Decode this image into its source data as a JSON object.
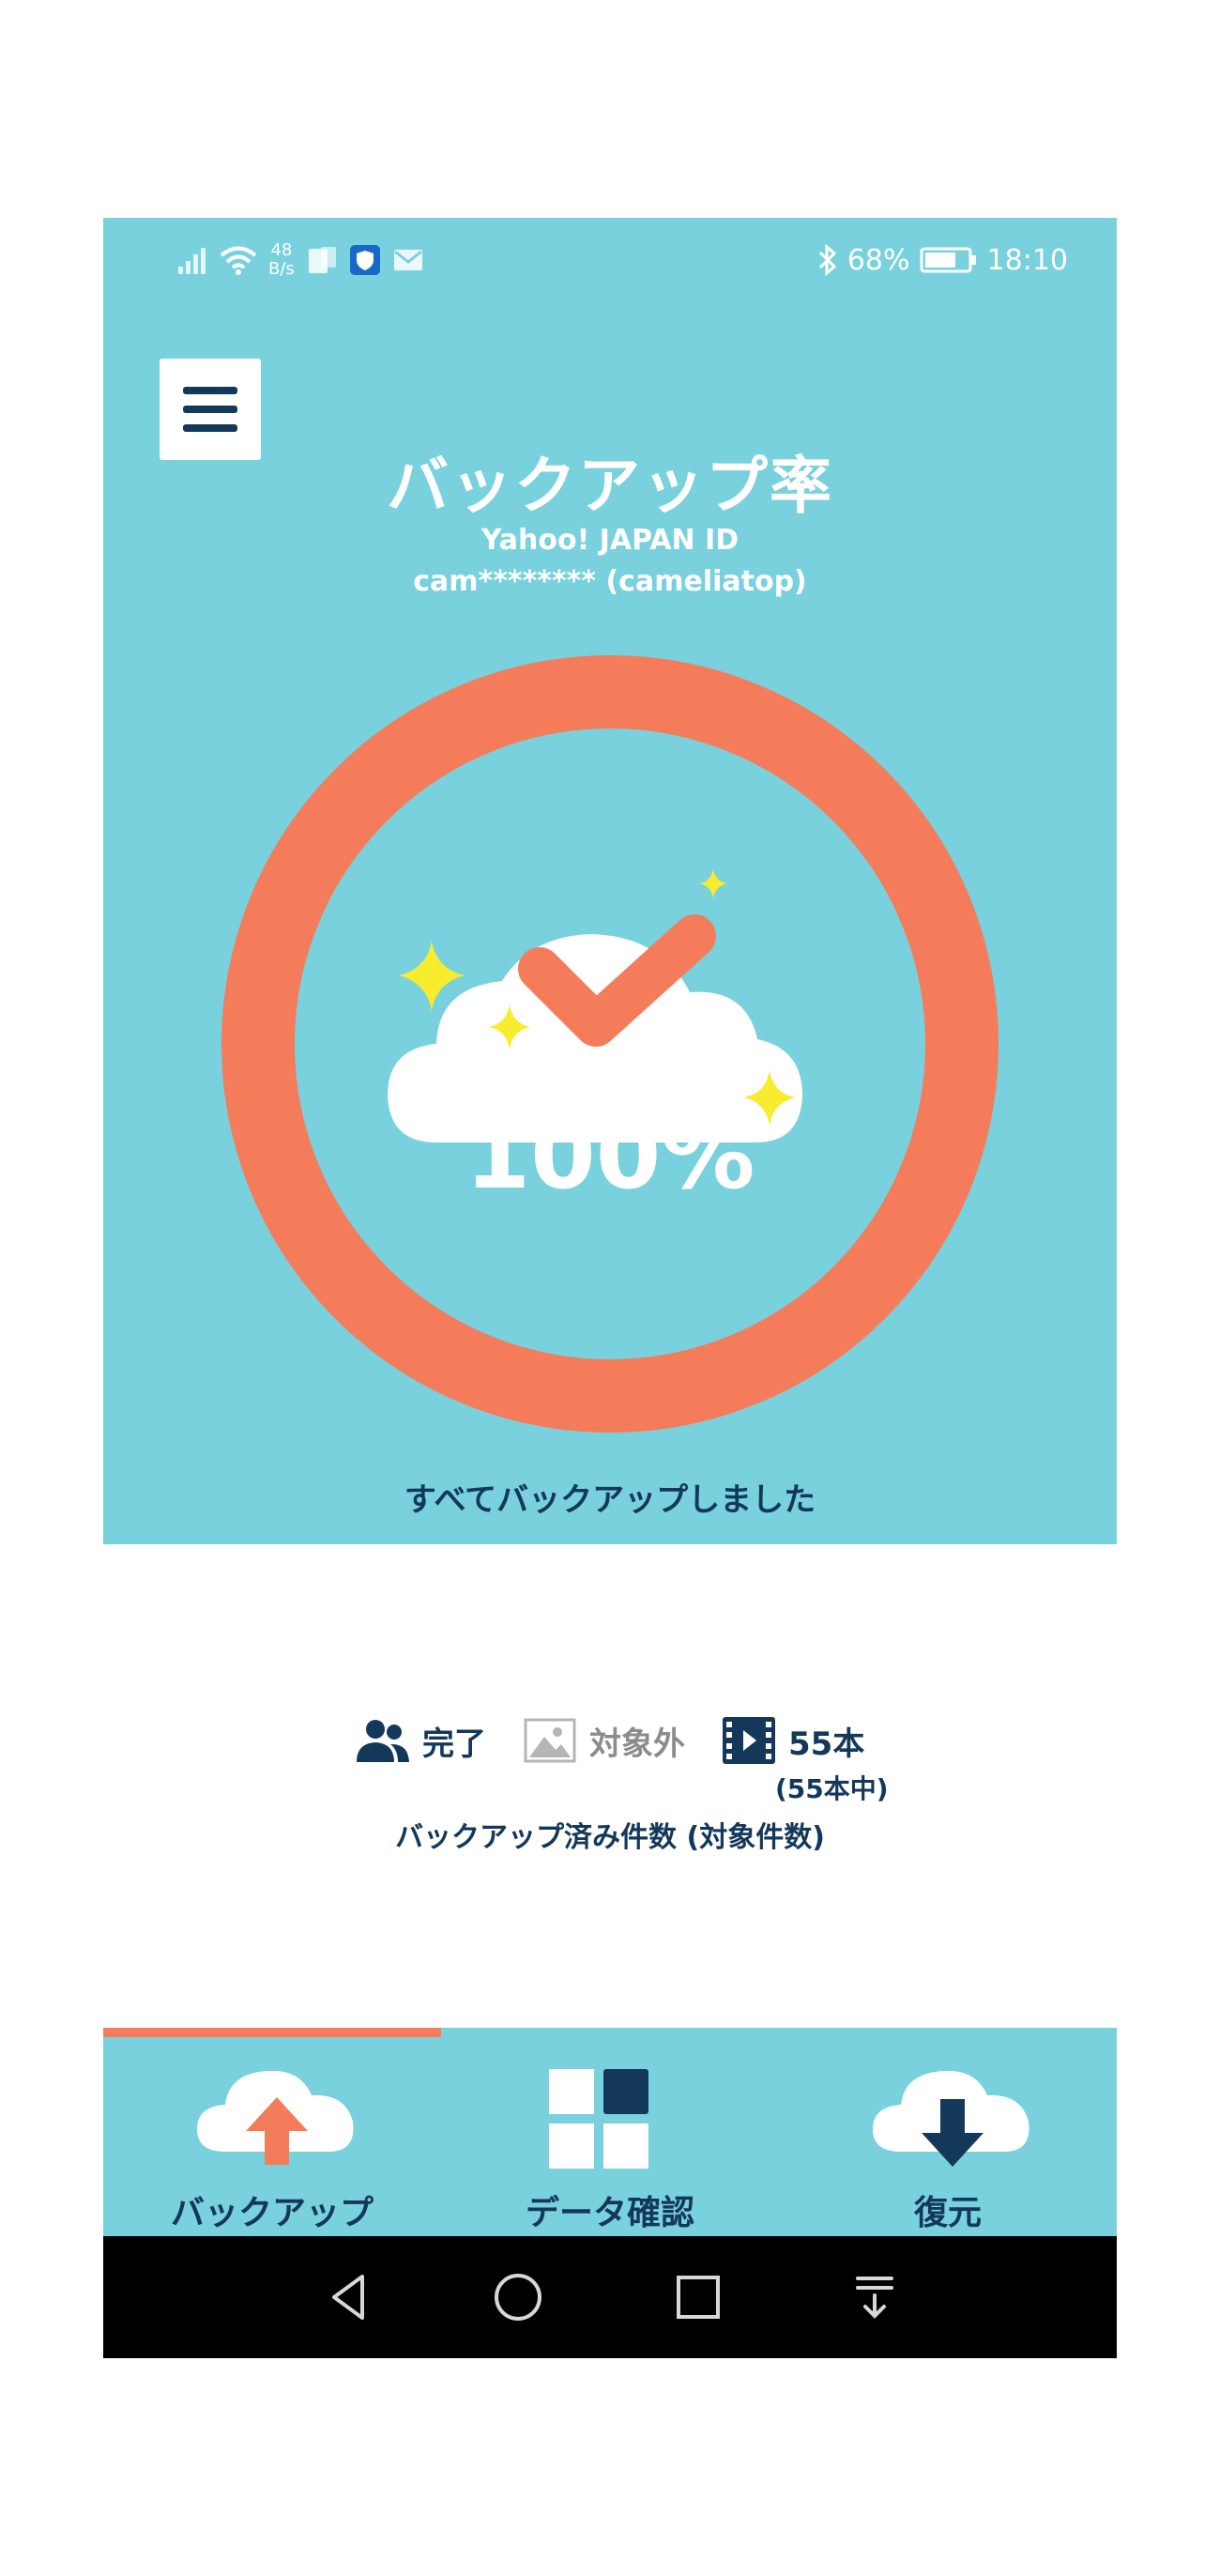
{
  "status_bar": {
    "net_speed_value": "48",
    "net_speed_unit": "B/s",
    "battery": "68%",
    "time": "18:10",
    "icons": [
      "signal-icon",
      "wifi-icon",
      "sim-icon",
      "shield-app-icon",
      "mail-icon",
      "bluetooth-icon",
      "battery-icon"
    ]
  },
  "header": {
    "menu_icon": "menu-icon",
    "title": "バックアップ率",
    "account_provider": "Yahoo! JAPAN ID",
    "account_id": "cam******** (cameliatop)"
  },
  "progress": {
    "percent_label": "100%",
    "value": 1.0,
    "ring_color": "#f47c5a",
    "icons": [
      "cloud-check-icon",
      "sparkle-icon"
    ],
    "message": "すべてバックアップしました"
  },
  "counts": {
    "contacts": {
      "icon": "contacts-icon",
      "label": "完了"
    },
    "photos": {
      "icon": "photo-icon",
      "label": "対象外"
    },
    "videos": {
      "icon": "video-icon",
      "label": "55本",
      "total": "(55本中)"
    },
    "caption": "バックアップ済み件数 (対象件数)"
  },
  "bottom_nav": {
    "items": [
      {
        "label": "バックアップ",
        "icon": "cloud-upload-icon",
        "active": true
      },
      {
        "label": "データ確認",
        "icon": "grid-icon",
        "active": false
      },
      {
        "label": "復元",
        "icon": "cloud-download-icon",
        "active": false
      }
    ]
  },
  "system_nav": {
    "buttons": [
      "back-icon",
      "home-icon",
      "recents-icon",
      "notification-drawer-icon"
    ]
  },
  "colors": {
    "accent_bg": "#79d1de",
    "accent_orange": "#f47c5a",
    "navy": "#14385a",
    "sparkle": "#f7ec2e"
  }
}
